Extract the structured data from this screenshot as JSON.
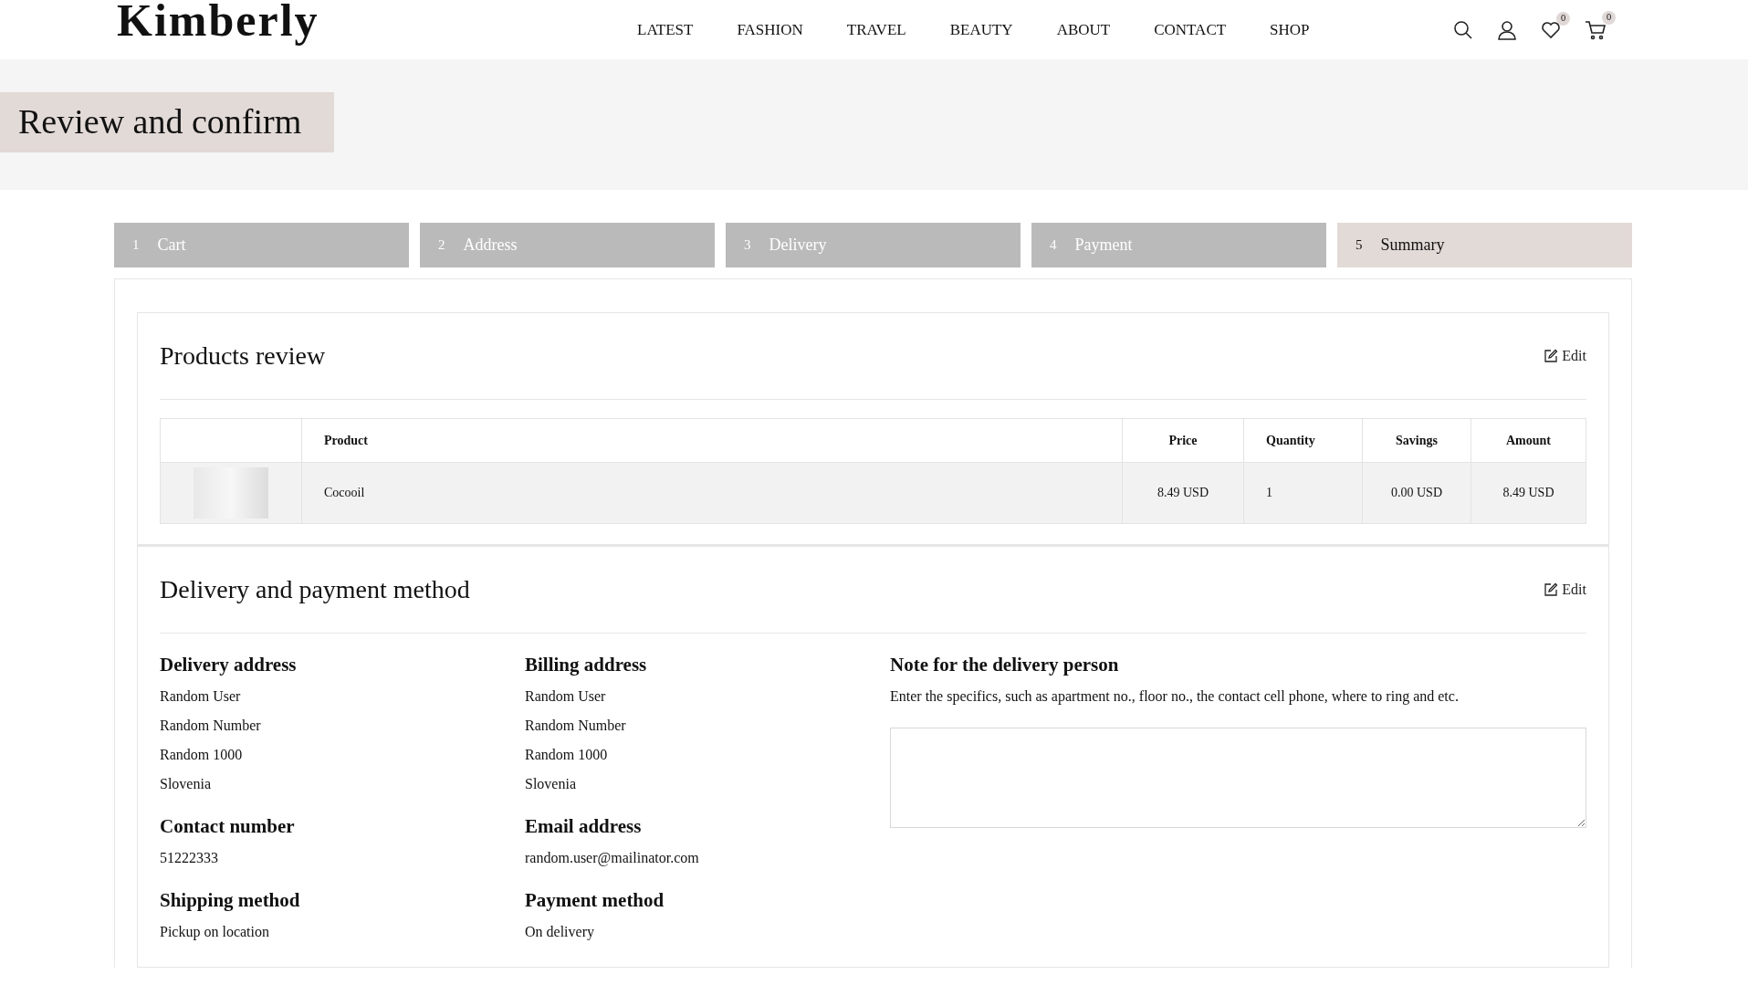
{
  "brand": "Kimberly",
  "nav": [
    "LATEST",
    "FASHION",
    "TRAVEL",
    "BEAUTY",
    "ABOUT",
    "CONTACT",
    "SHOP"
  ],
  "header_icons": {
    "wishlist_count": "0",
    "cart_count": "0"
  },
  "page_title": "Review and confirm",
  "steps": [
    {
      "number": "1",
      "label": "Cart",
      "selected": false
    },
    {
      "number": "2",
      "label": "Address",
      "selected": false
    },
    {
      "number": "3",
      "label": "Delivery",
      "selected": false
    },
    {
      "number": "4",
      "label": "Payment",
      "selected": false
    },
    {
      "number": "5",
      "label": "Summary",
      "selected": true
    }
  ],
  "products_review": {
    "title": "Products review",
    "edit": "Edit",
    "table": {
      "columns": [
        "Product",
        "Price",
        "Quantity",
        "Savings",
        "Amount"
      ],
      "rows": [
        {
          "product": "Cocooil",
          "price": "8.49 USD",
          "quantity": "1",
          "savings": "0.00 USD",
          "amount": "8.49 USD"
        }
      ]
    }
  },
  "delivery_payment": {
    "title": "Delivery and payment method",
    "edit": "Edit",
    "blocks": [
      {
        "heading": "Delivery address",
        "lines": [
          "Random User",
          "Random Number",
          "Random 1000",
          "Slovenia"
        ]
      },
      {
        "heading": "Billing address",
        "lines": [
          "Random User",
          "Random Number",
          "Random 1000",
          "Slovenia"
        ]
      },
      {
        "heading": "Contact number",
        "lines": [
          "51222333"
        ]
      },
      {
        "heading": "Email address",
        "lines": [
          "random.user@mailinator.com"
        ]
      },
      {
        "heading": "Shipping method",
        "lines": [
          "Pickup on location"
        ]
      },
      {
        "heading": "Payment method",
        "lines": [
          "On delivery"
        ]
      }
    ],
    "note": {
      "heading": "Note for the delivery person",
      "hint": "Enter the specifics, such as apartment no., floor no., the contact cell phone, where to ring and etc."
    }
  }
}
